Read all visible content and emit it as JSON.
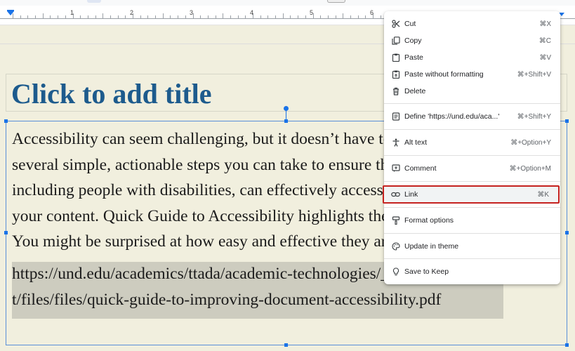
{
  "ruler": {
    "numbers": [
      "1",
      "2",
      "3",
      "4",
      "5",
      "6"
    ]
  },
  "slide": {
    "title": "Click to add title",
    "body_lines": [
      "Accessibility can seem challenging, but it doesn’t have to be. There are",
      "several simple, actionable steps you can take to ensure that everyone,",
      "including people with disabilities, can effectively access and engage with",
      "your content. Quick Guide to Accessibility highlights these steps.",
      "You might be surprised at how easy and effective they are."
    ],
    "link_lines": [
      "https://und.edu/academics/ttada/academic-technologies/_files/docs/conten",
      "t/files/files/quick-guide-to-improving-document-accessibility.pdf"
    ]
  },
  "context_menu": {
    "items": [
      {
        "label": "Cut",
        "shortcut": "⌘X",
        "icon": "scissors-icon"
      },
      {
        "label": "Copy",
        "shortcut": "⌘C",
        "icon": "copy-icon"
      },
      {
        "label": "Paste",
        "shortcut": "⌘V",
        "icon": "clipboard-icon"
      },
      {
        "label": "Paste without formatting",
        "shortcut": "⌘+Shift+V",
        "icon": "clipboard-plain-icon"
      },
      {
        "label": "Delete",
        "shortcut": "",
        "icon": "trash-icon"
      },
      {
        "label": "Define 'https://und.edu/aca...'",
        "shortcut": "⌘+Shift+Y",
        "icon": "book-icon"
      },
      {
        "label": "Alt text",
        "shortcut": "⌘+Option+Y",
        "icon": "accessibility-icon"
      },
      {
        "label": "Comment",
        "shortcut": "⌘+Option+M",
        "icon": "comment-icon"
      },
      {
        "label": "Link",
        "shortcut": "⌘K",
        "icon": "link-icon"
      },
      {
        "label": "Format options",
        "shortcut": "",
        "icon": "format-paint-icon"
      },
      {
        "label": "Update in theme",
        "shortcut": "",
        "icon": "palette-icon"
      },
      {
        "label": "Save to Keep",
        "shortcut": "",
        "icon": "lightbulb-icon"
      }
    ]
  },
  "colors": {
    "title": "#1d5b8d",
    "selection": "#1a73e8",
    "highlight_border": "#c5221f",
    "slide_bg": "#f1efde"
  }
}
